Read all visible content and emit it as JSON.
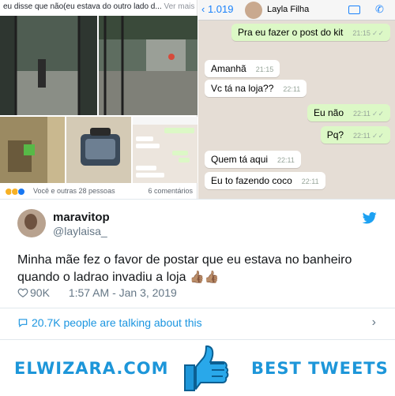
{
  "facebook": {
    "caption": "eu disse que não(eu estava do outro lado d...",
    "more_label": "Ver mais",
    "reactions_text": "Você e outras 28 pessoas",
    "comments_text": "6 comentários"
  },
  "whatsapp": {
    "back_label": "1.019",
    "contact_name": "Layla Filha",
    "messages": [
      {
        "text": "Pra eu fazer o post do kit",
        "time": "21:15",
        "dir": "out"
      },
      {
        "text": "Amanhã",
        "time": "21:15",
        "dir": "in"
      },
      {
        "text": "Vc tá na loja??",
        "time": "22:11",
        "dir": "in"
      },
      {
        "text": "Eu não",
        "time": "22:11",
        "dir": "out"
      },
      {
        "text": "Pq?",
        "time": "22:11",
        "dir": "out"
      },
      {
        "text": "Quem tá aqui",
        "time": "22:11",
        "dir": "in"
      },
      {
        "text": "Eu to fazendo coco",
        "time": "22:11",
        "dir": "in"
      }
    ]
  },
  "tweet": {
    "name": "maravitop",
    "handle": "@laylaisa_",
    "text": "Minha mãe fez o favor de postar que eu estava no banheiro quando o ladrao invadiu a loja",
    "emoji": "👍🏽👍🏽",
    "likes": "90K",
    "timestamp": "1:57 AM - Jan 3, 2019",
    "talking": "20.7K people are talking about this"
  },
  "brand": {
    "left": "ELWIZARA.COM",
    "right": "BEST TWEETS"
  },
  "colors": {
    "twitter_blue": "#1da1f2",
    "brand_blue": "#1d96d9",
    "wa_out": "#dcf8c6",
    "wa_bg": "#e5ddd5"
  }
}
